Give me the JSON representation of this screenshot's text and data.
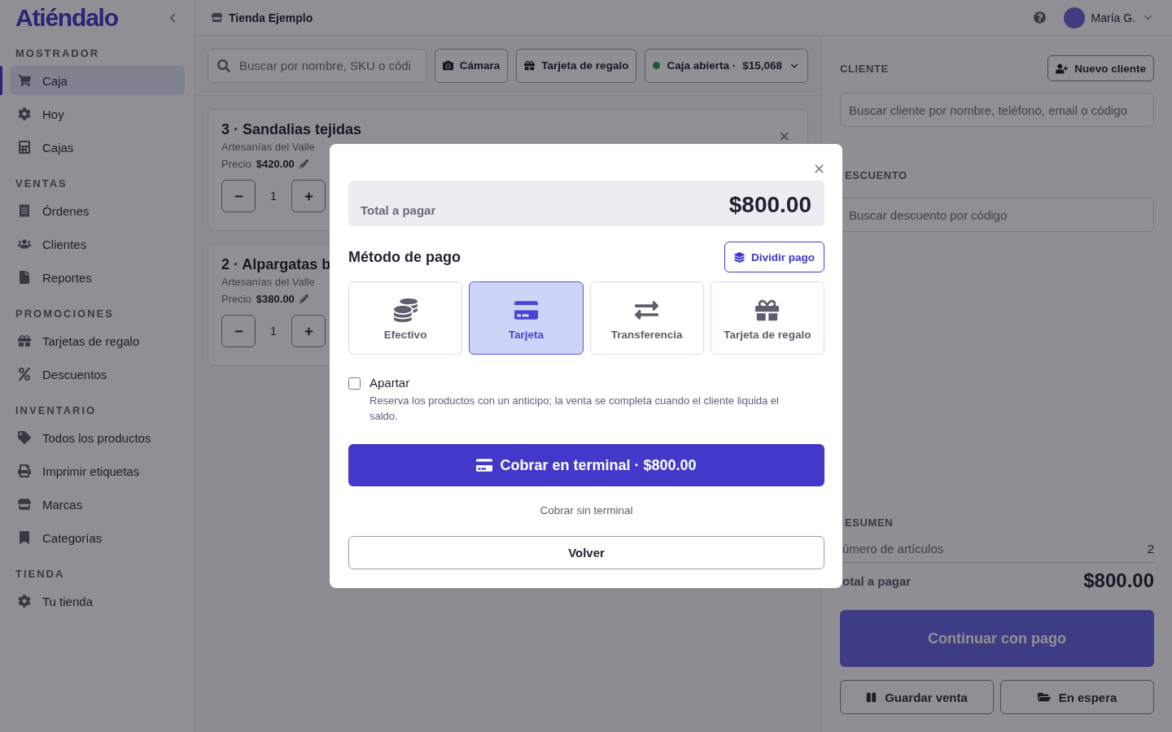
{
  "sidebar": {
    "logo": "Atiéndalo",
    "sections": [
      {
        "title": "MOSTRADOR",
        "items": [
          {
            "label": "Caja",
            "selected": true
          },
          {
            "label": "Hoy",
            "selected": false
          },
          {
            "label": "Cajas",
            "selected": false
          }
        ]
      },
      {
        "title": "VENTAS",
        "items": [
          {
            "label": "Órdenes",
            "selected": false
          },
          {
            "label": "Clientes",
            "selected": false
          },
          {
            "label": "Reportes",
            "selected": false
          }
        ]
      },
      {
        "title": "PROMOCIONES",
        "items": [
          {
            "label": "Tarjetas de regalo",
            "selected": false
          },
          {
            "label": "Descuentos",
            "selected": false
          }
        ]
      },
      {
        "title": "INVENTARIO",
        "items": [
          {
            "label": "Todos los productos",
            "selected": false
          },
          {
            "label": "Imprimir etiquetas",
            "selected": false
          },
          {
            "label": "Marcas",
            "selected": false
          },
          {
            "label": "Categorías",
            "selected": false
          }
        ]
      },
      {
        "title": "TIENDA",
        "items": [
          {
            "label": "Tu tienda",
            "selected": false
          }
        ]
      }
    ]
  },
  "header": {
    "store": "Tienda Ejemplo",
    "user": "María G."
  },
  "toolbar": {
    "search_placeholder": "Buscar por nombre, SKU o códi",
    "buttons": [
      "Cámara",
      "Tarjeta de regalo"
    ],
    "register": {
      "label": "Caja abierta ·",
      "amount": "$15,068"
    }
  },
  "cart": [
    {
      "title": "3 · Sandalias tejidas",
      "brand": "Artesanías del Valle",
      "price_label": "Precio",
      "price": "$420.00",
      "quantity": "1",
      "remove": "×"
    },
    {
      "title": "2 · Alpargatas b",
      "brand": "Artesanías del Valle",
      "price_label": "Precio",
      "price": "$380.00",
      "quantity": "1"
    }
  ],
  "right_panel": {
    "client_label": "CLIENTE",
    "new_client": "Nuevo cliente",
    "client_placeholder": "Buscar cliente por nombre, teléfono, email o código",
    "discount_label": "ESCUENTO",
    "discount_placeholder": "Buscar descuento por código",
    "summary_label": "ESUMEN",
    "items_label": "úmero de artículos",
    "items_value": "2",
    "total_label": "otal a pagar",
    "total_value": "$800.00",
    "continue": "Continuar con pago",
    "save": "Guardar venta",
    "hold": "En espera"
  },
  "modal": {
    "total_label": "Total a pagar",
    "total_value": "$800.00",
    "method_title": "Método de pago",
    "split": "Dividir pago",
    "methods": [
      {
        "label": "Efectivo",
        "selected": false
      },
      {
        "label": "Tarjeta",
        "selected": true
      },
      {
        "label": "Transferencia",
        "selected": false
      },
      {
        "label": "Tarjeta de regalo",
        "selected": false
      }
    ],
    "layaway": {
      "label": "Apartar",
      "checked": false,
      "description": "Reserva los productos con un anticipo; la venta se completa cuando el cliente liquida el saldo."
    },
    "charge": "Cobrar en terminal · $800.00",
    "no_terminal": "Cobrar sin terminal",
    "back": "Volver"
  }
}
